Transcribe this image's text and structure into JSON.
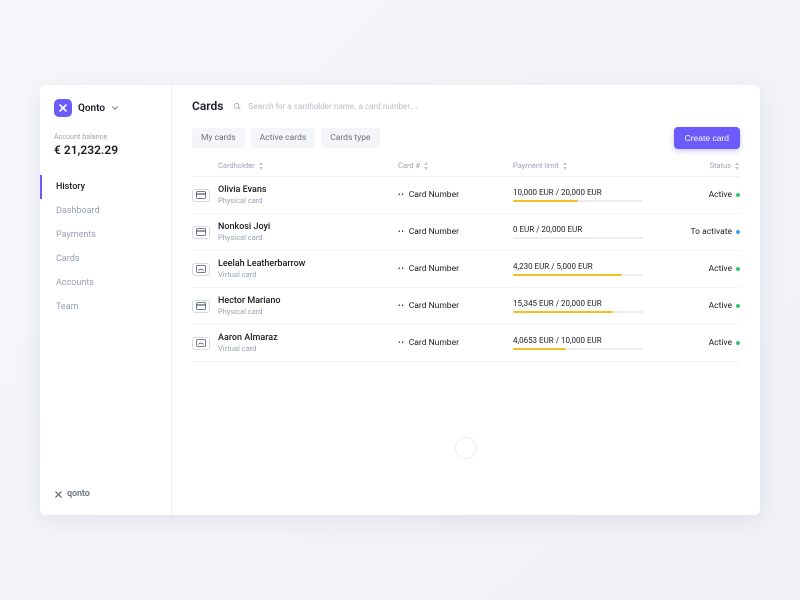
{
  "brand": {
    "name": "Qonto",
    "footer": "qonto"
  },
  "balance": {
    "label": "Account balance",
    "value": "€ 21,232.29"
  },
  "nav": {
    "items": [
      "History",
      "Dashboard",
      "Payments",
      "Cards",
      "Accounts",
      "Team"
    ],
    "activeIndex": 0
  },
  "header": {
    "title": "Cards",
    "searchPlaceholder": "Search for a cardholder name, a card number…"
  },
  "filters": [
    "My cards",
    "Active cards",
    "Cards type"
  ],
  "actions": {
    "create": "Create card"
  },
  "columns": {
    "cardholder": "Cardholder",
    "cardnum": "Card #",
    "limit": "Payment limit",
    "status": "Status"
  },
  "rows": [
    {
      "name": "Olivia Evans",
      "type": "Physical card",
      "masked": "Card Number",
      "limit": "10,000 EUR / 20,000 EUR",
      "pct": 50,
      "status": "Active",
      "statusKind": "active",
      "icon": "physical"
    },
    {
      "name": "Nonkosi Joyi",
      "type": "Physical card",
      "masked": "Card Number",
      "limit": "0 EUR / 20,000 EUR",
      "pct": 0,
      "status": "To activate",
      "statusKind": "pending",
      "icon": "physical"
    },
    {
      "name": "Leelah Leatherbarrow",
      "type": "Virtual card",
      "masked": "Card Number",
      "limit": "4,230 EUR / 5,000 EUR",
      "pct": 84,
      "status": "Active",
      "statusKind": "active",
      "icon": "virtual"
    },
    {
      "name": "Hector Mariano",
      "type": "Physical card",
      "masked": "Card Number",
      "limit": "15,345 EUR / 20,000 EUR",
      "pct": 77,
      "status": "Active",
      "statusKind": "active",
      "icon": "physical"
    },
    {
      "name": "Aaron Almaraz",
      "type": "Virtual card",
      "masked": "Card Number",
      "limit": "4,0653 EUR / 10,000 EUR",
      "pct": 41,
      "status": "Active",
      "statusKind": "active",
      "icon": "virtual"
    }
  ]
}
